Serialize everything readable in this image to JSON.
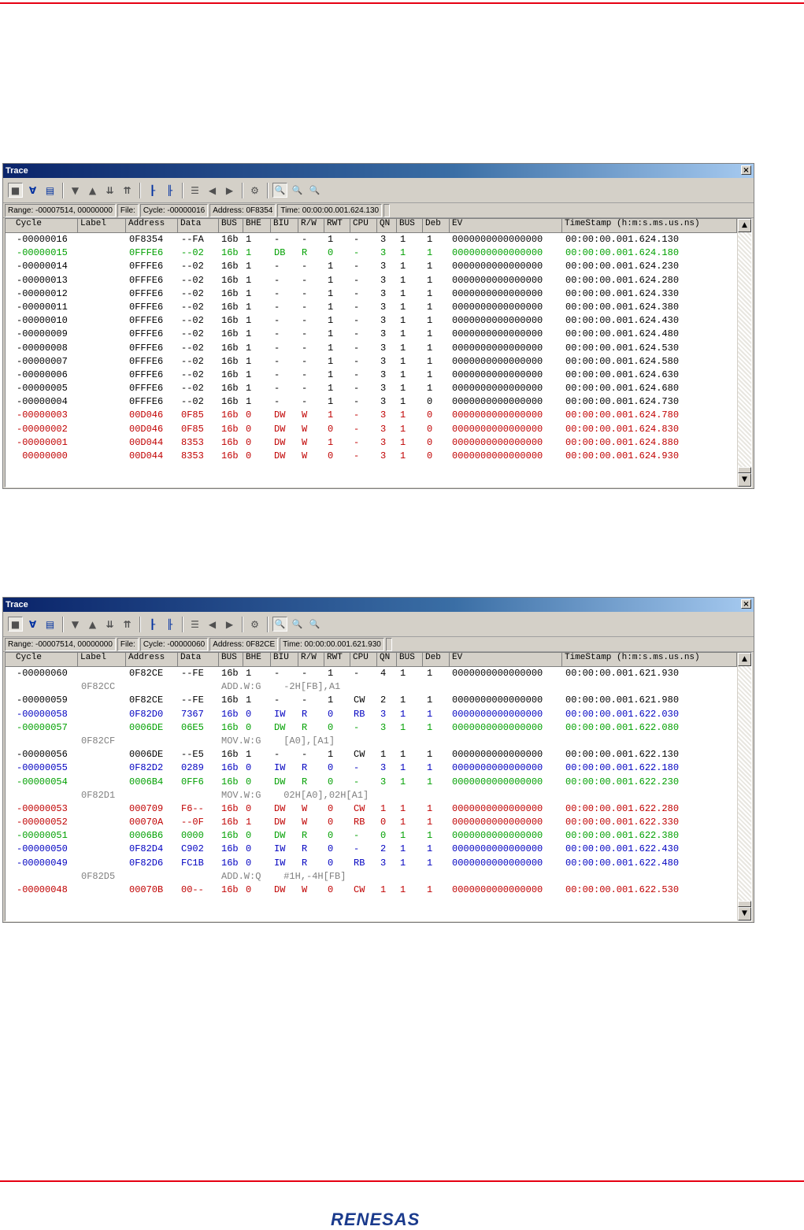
{
  "colors": {
    "black": "#000000",
    "green": "#00a000",
    "blue": "#0000c0",
    "red": "#c00000",
    "gray": "#808080"
  },
  "logo_text": "RENESAS",
  "columns": [
    "Cycle",
    "Label",
    "Address",
    "Data",
    "BUS",
    "BHE",
    "BIU",
    "R/W",
    "RWT",
    "CPU",
    "QN",
    "BUS",
    "Deb",
    "EV",
    "TimeStamp (h:m:s.ms.us.ns)"
  ],
  "toolbar_icons": [
    "record-icon",
    "filter-icon",
    "document-icon",
    "step-down-icon",
    "step-up-icon",
    "jump-bottom-icon",
    "jump-top-icon",
    "tree-icon",
    "tree-alt-icon",
    "list-icon",
    "prev-icon",
    "next-icon",
    "properties-icon",
    "search-icon",
    "search-next-icon",
    "search-prev-icon"
  ],
  "windows": [
    {
      "title": "Trace",
      "close": "×",
      "status": {
        "range": "Range: -00007514, 00000000",
        "file": "File:",
        "cycle": "Cycle: -00000016",
        "address": "Address: 0F8354",
        "time": "Time: 00:00:00.001.624.130"
      },
      "rows": [
        {
          "color": "black",
          "cells": [
            "-00000016",
            "",
            "0F8354",
            "--FA",
            "16b",
            "1",
            "-",
            "-",
            "1",
            "-",
            "3",
            "1",
            "1",
            "0000000000000000",
            "00:00:00.001.624.130"
          ]
        },
        {
          "color": "green",
          "cells": [
            "-00000015",
            "",
            "0FFFE6",
            "--02",
            "16b",
            "1",
            "DB",
            "R",
            "0",
            "-",
            "3",
            "1",
            "1",
            "0000000000000000",
            "00:00:00.001.624.180"
          ]
        },
        {
          "color": "black",
          "cells": [
            "-00000014",
            "",
            "0FFFE6",
            "--02",
            "16b",
            "1",
            "-",
            "-",
            "1",
            "-",
            "3",
            "1",
            "1",
            "0000000000000000",
            "00:00:00.001.624.230"
          ]
        },
        {
          "color": "black",
          "cells": [
            "-00000013",
            "",
            "0FFFE6",
            "--02",
            "16b",
            "1",
            "-",
            "-",
            "1",
            "-",
            "3",
            "1",
            "1",
            "0000000000000000",
            "00:00:00.001.624.280"
          ]
        },
        {
          "color": "black",
          "cells": [
            "-00000012",
            "",
            "0FFFE6",
            "--02",
            "16b",
            "1",
            "-",
            "-",
            "1",
            "-",
            "3",
            "1",
            "1",
            "0000000000000000",
            "00:00:00.001.624.330"
          ]
        },
        {
          "color": "black",
          "cells": [
            "-00000011",
            "",
            "0FFFE6",
            "--02",
            "16b",
            "1",
            "-",
            "-",
            "1",
            "-",
            "3",
            "1",
            "1",
            "0000000000000000",
            "00:00:00.001.624.380"
          ]
        },
        {
          "color": "black",
          "cells": [
            "-00000010",
            "",
            "0FFFE6",
            "--02",
            "16b",
            "1",
            "-",
            "-",
            "1",
            "-",
            "3",
            "1",
            "1",
            "0000000000000000",
            "00:00:00.001.624.430"
          ]
        },
        {
          "color": "black",
          "cells": [
            "-00000009",
            "",
            "0FFFE6",
            "--02",
            "16b",
            "1",
            "-",
            "-",
            "1",
            "-",
            "3",
            "1",
            "1",
            "0000000000000000",
            "00:00:00.001.624.480"
          ]
        },
        {
          "color": "black",
          "cells": [
            "-00000008",
            "",
            "0FFFE6",
            "--02",
            "16b",
            "1",
            "-",
            "-",
            "1",
            "-",
            "3",
            "1",
            "1",
            "0000000000000000",
            "00:00:00.001.624.530"
          ]
        },
        {
          "color": "black",
          "cells": [
            "-00000007",
            "",
            "0FFFE6",
            "--02",
            "16b",
            "1",
            "-",
            "-",
            "1",
            "-",
            "3",
            "1",
            "1",
            "0000000000000000",
            "00:00:00.001.624.580"
          ]
        },
        {
          "color": "black",
          "cells": [
            "-00000006",
            "",
            "0FFFE6",
            "--02",
            "16b",
            "1",
            "-",
            "-",
            "1",
            "-",
            "3",
            "1",
            "1",
            "0000000000000000",
            "00:00:00.001.624.630"
          ]
        },
        {
          "color": "black",
          "cells": [
            "-00000005",
            "",
            "0FFFE6",
            "--02",
            "16b",
            "1",
            "-",
            "-",
            "1",
            "-",
            "3",
            "1",
            "1",
            "0000000000000000",
            "00:00:00.001.624.680"
          ]
        },
        {
          "color": "black",
          "cells": [
            "-00000004",
            "",
            "0FFFE6",
            "--02",
            "16b",
            "1",
            "-",
            "-",
            "1",
            "-",
            "3",
            "1",
            "0",
            "0000000000000000",
            "00:00:00.001.624.730"
          ]
        },
        {
          "color": "red",
          "cells": [
            "-00000003",
            "",
            "00D046",
            "0F85",
            "16b",
            "0",
            "DW",
            "W",
            "1",
            "-",
            "3",
            "1",
            "0",
            "0000000000000000",
            "00:00:00.001.624.780"
          ]
        },
        {
          "color": "red",
          "cells": [
            "-00000002",
            "",
            "00D046",
            "0F85",
            "16b",
            "0",
            "DW",
            "W",
            "0",
            "-",
            "3",
            "1",
            "0",
            "0000000000000000",
            "00:00:00.001.624.830"
          ]
        },
        {
          "color": "red",
          "cells": [
            "-00000001",
            "",
            "00D044",
            "8353",
            "16b",
            "0",
            "DW",
            "W",
            "1",
            "-",
            "3",
            "1",
            "0",
            "0000000000000000",
            "00:00:00.001.624.880"
          ]
        },
        {
          "color": "red",
          "cells": [
            " 00000000",
            "",
            "00D044",
            "8353",
            "16b",
            "0",
            "DW",
            "W",
            "0",
            "-",
            "3",
            "1",
            "0",
            "0000000000000000",
            "00:00:00.001.624.930"
          ]
        }
      ]
    },
    {
      "title": "Trace",
      "close": "×",
      "status": {
        "range": "Range: -00007514, 00000000",
        "file": "File:",
        "cycle": "Cycle: -00000060",
        "address": "Address: 0F82CE",
        "time": "Time: 00:00:00.001.621.930"
      },
      "rows": [
        {
          "color": "black",
          "cells": [
            "-00000060",
            "",
            "0F82CE",
            "--FE",
            "16b",
            "1",
            "-",
            "-",
            "1",
            "-",
            "4",
            "1",
            "1",
            "0000000000000000",
            "00:00:00.001.621.930"
          ]
        },
        {
          "dis": true,
          "addr": "0F82CC",
          "text": "ADD.W:G    -2H[FB],A1"
        },
        {
          "color": "black",
          "cells": [
            "-00000059",
            "",
            "0F82CE",
            "--FE",
            "16b",
            "1",
            "-",
            "-",
            "1",
            "CW",
            "2",
            "1",
            "1",
            "0000000000000000",
            "00:00:00.001.621.980"
          ]
        },
        {
          "color": "blue",
          "cells": [
            "-00000058",
            "",
            "0F82D0",
            "7367",
            "16b",
            "0",
            "IW",
            "R",
            "0",
            "RB",
            "3",
            "1",
            "1",
            "0000000000000000",
            "00:00:00.001.622.030"
          ]
        },
        {
          "color": "green",
          "cells": [
            "-00000057",
            "",
            "0006DE",
            "06E5",
            "16b",
            "0",
            "DW",
            "R",
            "0",
            "-",
            "3",
            "1",
            "1",
            "0000000000000000",
            "00:00:00.001.622.080"
          ]
        },
        {
          "dis": true,
          "addr": "0F82CF",
          "text": "MOV.W:G    [A0],[A1]"
        },
        {
          "color": "black",
          "cells": [
            "-00000056",
            "",
            "0006DE",
            "--E5",
            "16b",
            "1",
            "-",
            "-",
            "1",
            "CW",
            "1",
            "1",
            "1",
            "0000000000000000",
            "00:00:00.001.622.130"
          ]
        },
        {
          "color": "blue",
          "cells": [
            "-00000055",
            "",
            "0F82D2",
            "0289",
            "16b",
            "0",
            "IW",
            "R",
            "0",
            "-",
            "3",
            "1",
            "1",
            "0000000000000000",
            "00:00:00.001.622.180"
          ]
        },
        {
          "color": "green",
          "cells": [
            "-00000054",
            "",
            "0006B4",
            "0FF6",
            "16b",
            "0",
            "DW",
            "R",
            "0",
            "-",
            "3",
            "1",
            "1",
            "0000000000000000",
            "00:00:00.001.622.230"
          ]
        },
        {
          "dis": true,
          "addr": "0F82D1",
          "text": "MOV.W:G    02H[A0],02H[A1]"
        },
        {
          "color": "red",
          "cells": [
            "-00000053",
            "",
            "000709",
            "F6--",
            "16b",
            "0",
            "DW",
            "W",
            "0",
            "CW",
            "1",
            "1",
            "1",
            "0000000000000000",
            "00:00:00.001.622.280"
          ]
        },
        {
          "color": "red",
          "cells": [
            "-00000052",
            "",
            "00070A",
            "--0F",
            "16b",
            "1",
            "DW",
            "W",
            "0",
            "RB",
            "0",
            "1",
            "1",
            "0000000000000000",
            "00:00:00.001.622.330"
          ]
        },
        {
          "color": "green",
          "cells": [
            "-00000051",
            "",
            "0006B6",
            "0000",
            "16b",
            "0",
            "DW",
            "R",
            "0",
            "-",
            "0",
            "1",
            "1",
            "0000000000000000",
            "00:00:00.001.622.380"
          ]
        },
        {
          "color": "blue",
          "cells": [
            "-00000050",
            "",
            "0F82D4",
            "C902",
            "16b",
            "0",
            "IW",
            "R",
            "0",
            "-",
            "2",
            "1",
            "1",
            "0000000000000000",
            "00:00:00.001.622.430"
          ]
        },
        {
          "color": "blue",
          "cells": [
            "-00000049",
            "",
            "0F82D6",
            "FC1B",
            "16b",
            "0",
            "IW",
            "R",
            "0",
            "RB",
            "3",
            "1",
            "1",
            "0000000000000000",
            "00:00:00.001.622.480"
          ]
        },
        {
          "dis": true,
          "addr": "0F82D5",
          "text": "ADD.W:Q    #1H,-4H[FB]"
        },
        {
          "color": "red",
          "cells": [
            "-00000048",
            "",
            "00070B",
            "00--",
            "16b",
            "0",
            "DW",
            "W",
            "0",
            "CW",
            "1",
            "1",
            "1",
            "0000000000000000",
            "00:00:00.001.622.530"
          ]
        }
      ]
    }
  ]
}
